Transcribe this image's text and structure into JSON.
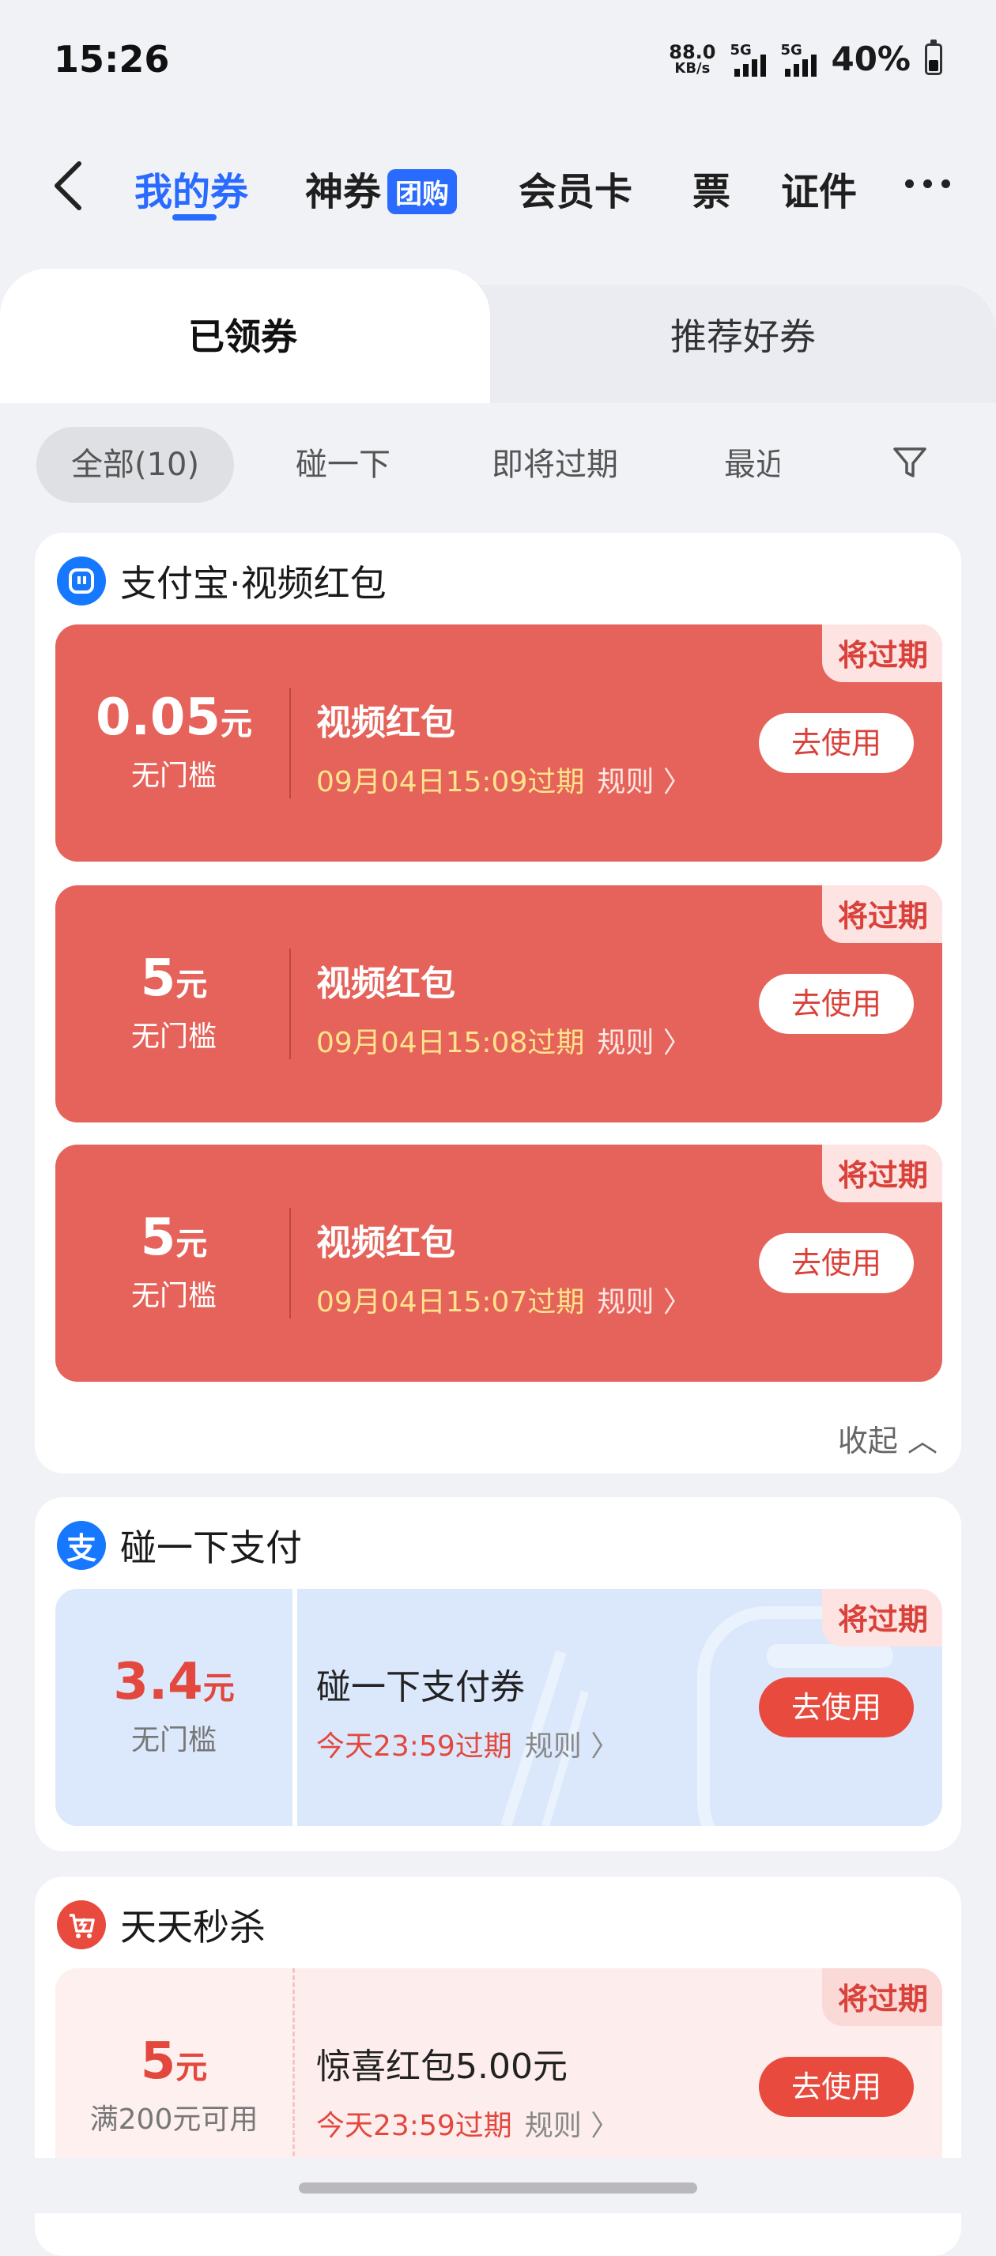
{
  "status_bar": {
    "time": "15:26",
    "speed_value": "88.0",
    "speed_unit": "KB/s",
    "signal1": "5G",
    "signal2": "5G",
    "battery": "40%"
  },
  "nav": {
    "tabs": [
      {
        "label": "我的券"
      },
      {
        "label": "神券"
      },
      {
        "label": "会员卡"
      },
      {
        "label": "票"
      },
      {
        "label": "证件"
      }
    ],
    "badge": "团购"
  },
  "subtabs": [
    "已领券",
    "推荐好券"
  ],
  "filters": [
    "全部(10)",
    "碰一下",
    "即将过期",
    "最近"
  ],
  "sections": [
    {
      "title": "支付宝·视频红包",
      "coupons": [
        {
          "amount": "0.05",
          "unit": "元",
          "cond": "无门槛",
          "name": "视频红包",
          "expiry": "09月04日15:09过期",
          "rule": "规则 〉",
          "tag": "将过期",
          "button": "去使用"
        },
        {
          "amount": "5",
          "unit": "元",
          "cond": "无门槛",
          "name": "视频红包",
          "expiry": "09月04日15:08过期",
          "rule": "规则 〉",
          "tag": "将过期",
          "button": "去使用"
        },
        {
          "amount": "5",
          "unit": "元",
          "cond": "无门槛",
          "name": "视频红包",
          "expiry": "09月04日15:07过期",
          "rule": "规则 〉",
          "tag": "将过期",
          "button": "去使用"
        }
      ],
      "collapse": "收起 ︿"
    },
    {
      "title": "碰一下支付",
      "logo_char": "支",
      "coupons": [
        {
          "amount": "3.4",
          "unit": "元",
          "cond": "无门槛",
          "name": "碰一下支付券",
          "expiry": "今天23:59过期",
          "rule": "规则 〉",
          "tag": "将过期",
          "button": "去使用"
        }
      ]
    },
    {
      "title": "天天秒杀",
      "coupons": [
        {
          "amount": "5",
          "unit": "元",
          "cond": "满200元可用",
          "name": "惊喜红包5.00元",
          "expiry": "今天23:59过期",
          "rule": "规则 〉",
          "tag": "将过期",
          "button": "去使用"
        }
      ]
    }
  ],
  "colors": {
    "accent": "#2a6bff",
    "coupon_red": "#e5635a",
    "alert_red": "#e84a3e"
  }
}
